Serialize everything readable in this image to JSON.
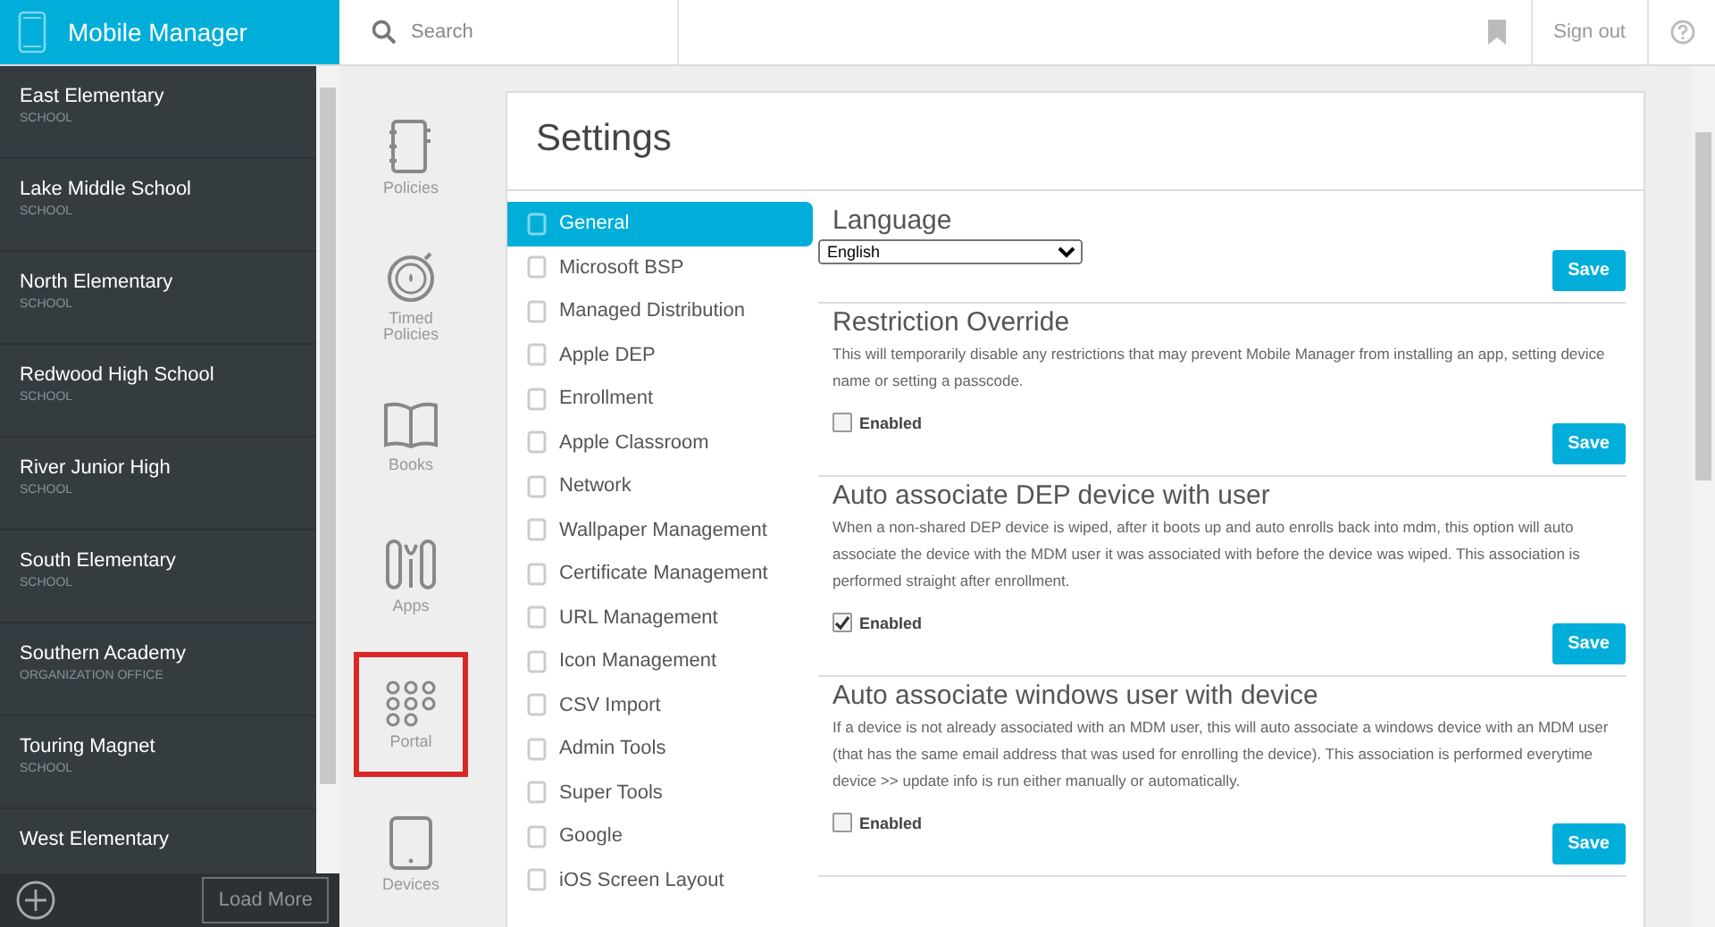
{
  "header": {
    "app_title": "Mobile Manager",
    "search": {
      "placeholder": "Search"
    },
    "sign_out": "Sign out"
  },
  "sidebar": {
    "items": [
      {
        "name": "East Elementary",
        "type": "SCHOOL"
      },
      {
        "name": "Lake Middle School",
        "type": "SCHOOL"
      },
      {
        "name": "North Elementary",
        "type": "SCHOOL"
      },
      {
        "name": "Redwood High School",
        "type": "SCHOOL"
      },
      {
        "name": "River Junior High",
        "type": "SCHOOL"
      },
      {
        "name": "South Elementary",
        "type": "SCHOOL"
      },
      {
        "name": "Southern Academy",
        "type": "ORGANIZATION OFFICE"
      },
      {
        "name": "Touring Magnet",
        "type": "SCHOOL"
      },
      {
        "name": "West Elementary"
      }
    ],
    "load_more": "Load More"
  },
  "rail": {
    "items": [
      {
        "label": "Policies",
        "highlighted": false
      },
      {
        "label": "Timed Policies",
        "highlighted": false
      },
      {
        "label": "Books",
        "highlighted": false
      },
      {
        "label": "Apps",
        "highlighted": false
      },
      {
        "label": "Portal",
        "highlighted": true
      },
      {
        "label": "Devices",
        "highlighted": false
      }
    ]
  },
  "settings": {
    "title": "Settings",
    "menu": [
      {
        "label": "General",
        "selected": true
      },
      {
        "label": "Microsoft BSP",
        "selected": false
      },
      {
        "label": "Managed Distribution",
        "selected": false
      },
      {
        "label": "Apple DEP",
        "selected": false
      },
      {
        "label": "Enrollment",
        "selected": false
      },
      {
        "label": "Apple Classroom",
        "selected": false
      },
      {
        "label": "Network",
        "selected": false
      },
      {
        "label": "Wallpaper Management",
        "selected": false
      },
      {
        "label": "Certificate Management",
        "selected": false
      },
      {
        "label": "URL Management",
        "selected": false
      },
      {
        "label": "Icon Management",
        "selected": false
      },
      {
        "label": "CSV Import",
        "selected": false
      },
      {
        "label": "Admin Tools",
        "selected": false
      },
      {
        "label": "Super Tools",
        "selected": false
      },
      {
        "label": "Google",
        "selected": false
      },
      {
        "label": "iOS Screen Layout",
        "selected": false
      }
    ],
    "sections": [
      {
        "kind": "select",
        "title": "Language",
        "value": "English",
        "button": "Save"
      },
      {
        "kind": "toggle",
        "title": "Restriction Override",
        "description": "This will temporarily disable any restrictions that may prevent Mobile Manager from installing an app, setting device name or setting a passcode.",
        "label": "Enabled",
        "checked": false,
        "button": "Save"
      },
      {
        "kind": "toggle",
        "title": "Auto associate DEP device with user",
        "description": "When a non-shared DEP device is wiped, after it boots up and auto enrolls back into mdm, this option will auto associate the device with the MDM user it was associated with before the device was wiped. This association is performed straight after enrollment.",
        "label": "Enabled",
        "checked": true,
        "button": "Save"
      },
      {
        "kind": "toggle",
        "title": "Auto associate windows user with device",
        "description": "If a device is not already associated with an MDM user, this will auto associate a windows device with an MDM user (that has the same email address that was used for enrolling the device). This association is performed everytime device >> update info is run either manually or automatically.",
        "label": "Enabled",
        "checked": false,
        "button": "Save"
      }
    ]
  }
}
